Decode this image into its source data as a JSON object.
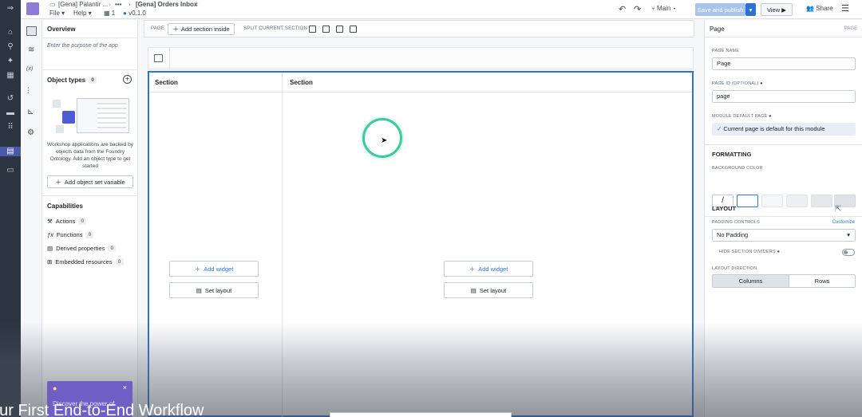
{
  "topbar": {
    "breadcrumb_parent": "[Gena] Palantir ...",
    "breadcrumb_ellipsis": "•••",
    "breadcrumb_current": "[Gena] Orders Inbox",
    "menu_file": "File",
    "menu_help": "Help",
    "page_count": "1",
    "version": "v0.1.0",
    "branch": "Main",
    "save_publish": "Save and publish",
    "view": "View",
    "share": "Share"
  },
  "left_panel": {
    "overview_title": "Overview",
    "purpose_placeholder": "Enter the purpose of the app",
    "object_types_label": "Object types",
    "object_types_count": "0",
    "description": "Workshop applications are backed by objects data from the Foundry Ontology. Add an object type to get started",
    "add_object_set": "Add object set variable",
    "capabilities_title": "Capabilities",
    "capabilities": [
      {
        "label": "Actions",
        "count": "0",
        "icon": "actions-icon"
      },
      {
        "label": "Functions",
        "count": "0",
        "icon": "function-icon"
      },
      {
        "label": "Derived properties",
        "count": "0",
        "icon": "table-icon"
      },
      {
        "label": "Embedded resources",
        "count": "0",
        "icon": "embed-icon"
      }
    ],
    "promo_text": "Discover the power of"
  },
  "toolbar": {
    "page_label": "PAGE",
    "add_section_inside": "Add section inside",
    "split_label": "SPLIT CURRENT SECTION"
  },
  "canvas": {
    "sections": [
      {
        "title": "Section",
        "add_widget": "Add widget",
        "set_layout": "Set layout"
      },
      {
        "title": "Section",
        "add_widget": "Add widget",
        "set_layout": "Set layout"
      }
    ]
  },
  "right_panel": {
    "title": "Page",
    "title_right": "PAGE",
    "page_name_label": "PAGE NAME",
    "page_name_value": "Page",
    "page_id_label": "PAGE ID",
    "page_id_optional": "(OPTIONAL)",
    "page_id_value": "page",
    "module_default_label": "MODULE DEFAULT PAGE",
    "module_default_text": "Current page is default for this module",
    "formatting_title": "FORMATTING",
    "bg_color_label": "BACKGROUND COLOR",
    "bg_none_glyph": "/",
    "layout_title": "LAYOUT",
    "padding_label": "PADDING CONTROLS",
    "customize": "Customize",
    "padding_value": "No Padding",
    "hide_dividers_label": "HIDE SECTION DIVIDERS",
    "layout_direction_label": "LAYOUT DIRECTION",
    "direction_columns": "Columns",
    "direction_rows": "Rows",
    "colors": {
      "accent": "#2d72d2",
      "selected_swatch_border": "#2d72d2",
      "brand": "#8d7ad9"
    }
  },
  "caption": "our First End-to-End Workflow"
}
